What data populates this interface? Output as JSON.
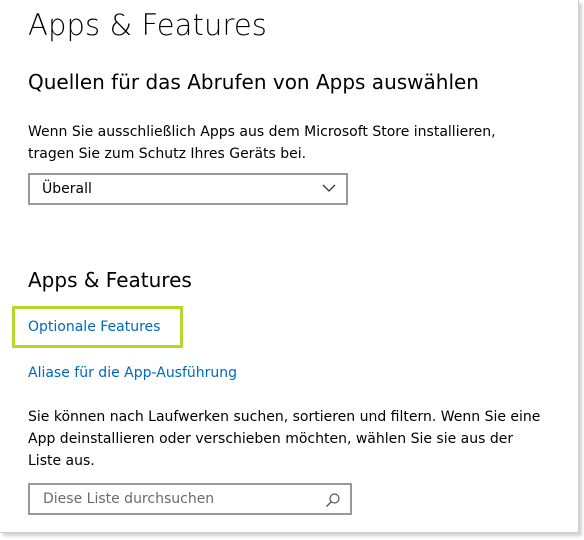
{
  "page": {
    "title": "Apps & Features"
  },
  "sources": {
    "title": "Quellen für das Abrufen von Apps auswählen",
    "description_line1": "Wenn Sie ausschließlich Apps aus dem Microsoft Store installieren,",
    "description_line2": "tragen Sie zum Schutz Ihres Geräts bei.",
    "select_value": "Überall",
    "select_icon": "chevron-down-icon"
  },
  "apps": {
    "title": "Apps & Features",
    "link_optional_features": "Optionale Features",
    "link_aliases": "Aliase für die App-Ausführung",
    "description_line1": "Sie können nach Laufwerken suchen, sortieren und filtern. Wenn Sie eine",
    "description_line2": "App deinstallieren oder verschieben möchten, wählen Sie sie aus der",
    "description_line3": "Liste aus.",
    "search_placeholder": "Diese Liste durchsuchen",
    "search_icon": "search-icon"
  },
  "colors": {
    "link": "#0067c0",
    "highlight": "#b4d92a",
    "control_border": "#999999",
    "placeholder": "#6b6b6b"
  }
}
